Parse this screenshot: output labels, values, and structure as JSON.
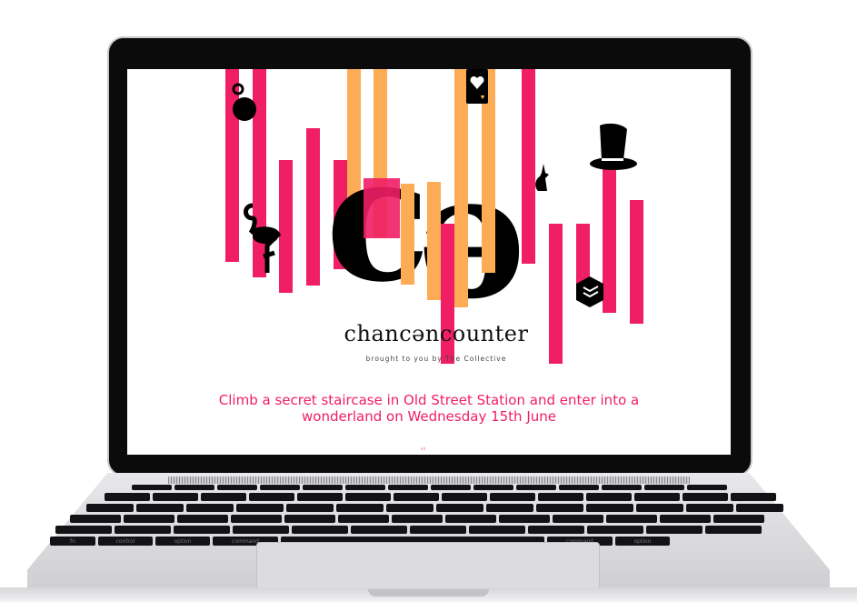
{
  "site": {
    "logo_text": "chancəncounter",
    "logo_subtitle": "brought to you by The Collective",
    "tagline": "Climb a secret staircase in Old Street Station and enter into a wonderland on Wednesday 15th June",
    "quote_mark": "“"
  },
  "colors": {
    "accent_pink": "#f01e64",
    "accent_orange": "#fdab55",
    "bezel": "#0b0b0b"
  },
  "icons": [
    "pocket-watch-icon",
    "flamingo-icon",
    "playing-card-heart-icon",
    "rabbit-icon",
    "top-hat-icon",
    "cube-logo-icon"
  ],
  "keyboard": {
    "bottom_row": [
      "fn",
      "control",
      "option",
      "command",
      "",
      "command",
      "option"
    ]
  }
}
